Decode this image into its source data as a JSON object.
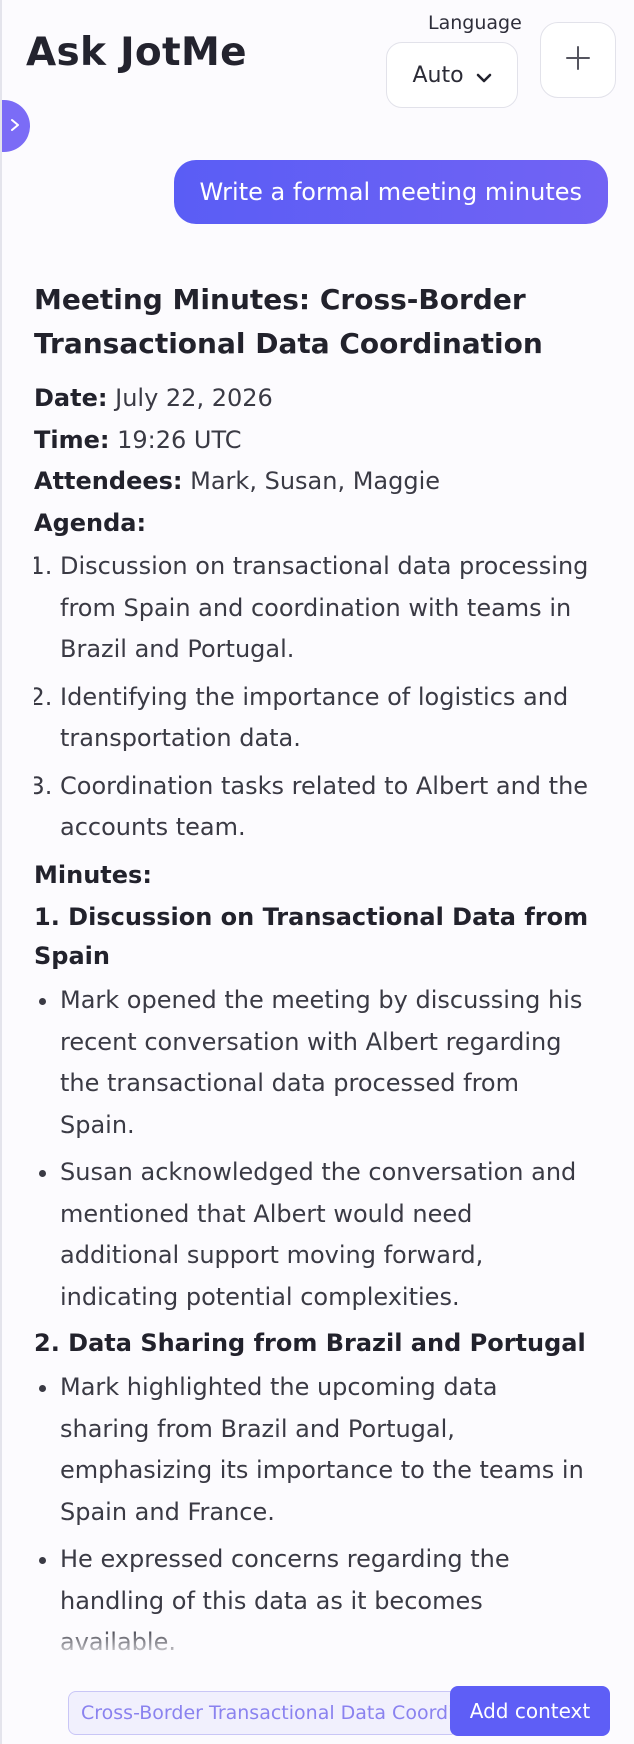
{
  "header": {
    "title": "Ask JotMe",
    "language_label": "Language",
    "language_value": "Auto"
  },
  "user_message": "Write a formal meeting minutes",
  "doc": {
    "title": "Meeting Minutes: Cross-Border Transactional Data Coordination",
    "date_label": "Date:",
    "date_value": "July 22, 2026",
    "time_label": "Time:",
    "time_value": "19:26 UTC",
    "attendees_label": "Attendees:",
    "attendees_value": "Mark, Susan, Maggie",
    "agenda_label": "Agenda:",
    "agenda": [
      "Discussion on transactional data processing from Spain and coordination with teams in Brazil and Portugal.",
      "Identifying the importance of logistics and transportation data.",
      "Coordination tasks related to Albert and the accounts team."
    ],
    "minutes_label": "Minutes:",
    "sections": [
      {
        "heading": "1. Discussion on Transactional Data from Spain",
        "bullets": [
          "Mark opened the meeting by discussing his recent conversation with Albert regarding the transactional data processed from Spain.",
          "Susan acknowledged the conversation and mentioned that Albert would need additional support moving forward, indicating potential complexities."
        ]
      },
      {
        "heading": "2. Data Sharing from Brazil and Portugal",
        "bullets": [
          "Mark highlighted the upcoming data sharing from Brazil and Portugal, emphasizing its importance to the teams in Spain and France.",
          "He expressed concerns regarding the handling of this data as it becomes available."
        ]
      }
    ]
  },
  "footer": {
    "context_value": "Cross-Border Transactional Data Coordination",
    "add_context_label": "Add context"
  },
  "colors": {
    "accent": "#5e5ef6",
    "accent_light": "#7b6cf6",
    "context_bg": "#f1f0fd"
  },
  "icons": {
    "language_dropdown": "chevron-down-icon",
    "new_chat": "plus-icon",
    "sidebar_toggle": "chevron-right-icon"
  }
}
